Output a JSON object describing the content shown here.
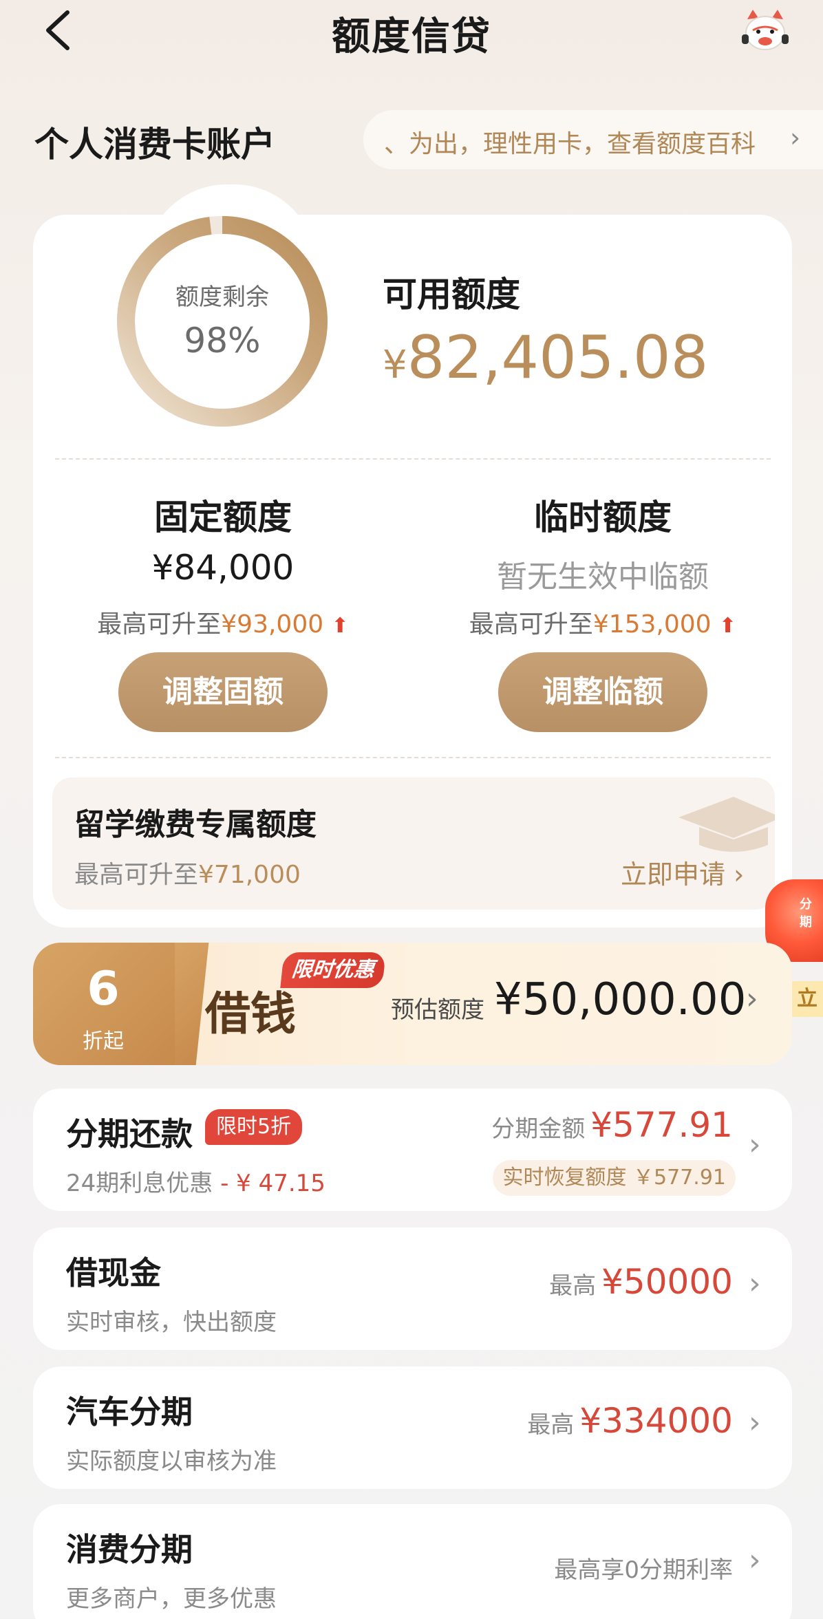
{
  "header": {
    "title": "额度信贷",
    "back_icon": "chevron-left-icon",
    "mascot_icon": "mascot-icon"
  },
  "account": {
    "title": "个人消费卡账户",
    "ticker_text": "、为出，理性用卡，查看额度百科",
    "ticker_arrow": "›"
  },
  "summary": {
    "ring_label": "额度剩余",
    "ring_value": "98%",
    "ring_fraction": 0.98,
    "available_label": "可用额度",
    "available_currency": "¥",
    "available_amount": "82,405.08"
  },
  "fixed": {
    "title": "固定额度",
    "value": "¥84,000",
    "upgrade_prefix": "最高可升至",
    "upgrade_value": "¥93,000",
    "button": "调整固额"
  },
  "temporary": {
    "title": "临时额度",
    "value": "暂无生效中临额",
    "upgrade_prefix": "最高可升至",
    "upgrade_value": "¥153,000",
    "button": "调整临额"
  },
  "study": {
    "title": "留学缴费专属额度",
    "sub_prefix": "最高可升至",
    "sub_value": "¥71,000",
    "cta": "立即申请 ›"
  },
  "side": {
    "float_text": "分期",
    "tag": "立"
  },
  "loan_banner": {
    "discount_num": "6",
    "discount_label": "折起",
    "title": "借钱",
    "badge": "限时优惠",
    "est_label": "预估额度",
    "est_value": "¥50,000.00",
    "arrow": "›"
  },
  "installment": {
    "title": "分期还款",
    "promo": "限时5折",
    "sub_prefix": "24期利息优惠",
    "sub_value": "- ¥ 47.15",
    "amount_label": "分期金额",
    "amount_value": "¥577.91",
    "restore": "实时恢复额度 ￥577.91",
    "arrow": "›"
  },
  "cash": {
    "title": "借现金",
    "sub": "实时审核，快出额度",
    "label": "最高",
    "value": "¥50000",
    "arrow": "›"
  },
  "auto": {
    "title": "汽车分期",
    "sub": "实际额度以审核为准",
    "label": "最高",
    "value": "¥334000",
    "arrow": "›"
  },
  "consumer": {
    "title": "消费分期",
    "sub": "更多商户，更多优惠",
    "right_text": "最高享0分期利率",
    "arrow": "›"
  },
  "colors": {
    "gold": "#b98e5b",
    "orange": "#d87a33",
    "red": "#d6483a",
    "button_gold": "#c7a176"
  }
}
